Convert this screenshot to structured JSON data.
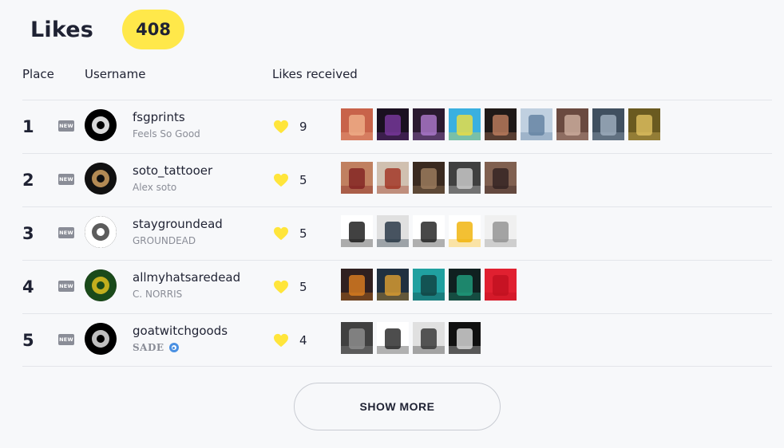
{
  "header": {
    "title": "Likes",
    "count": "408"
  },
  "columns": {
    "place": "Place",
    "username": "Username",
    "likes": "Likes received"
  },
  "new_label": "NEW",
  "rows": [
    {
      "place": "1",
      "username": "fsgprints",
      "subname": "Feels So Good",
      "likes": "9",
      "avatar_colors": [
        "#000000",
        "#ffffff"
      ],
      "thumb_colors": [
        [
          "#c8634a",
          "#f0b08a"
        ],
        [
          "#1a1020",
          "#7a3aa0"
        ],
        [
          "#2a1a30",
          "#b07ad0"
        ],
        [
          "#3ab0e0",
          "#f0e040"
        ],
        [
          "#201a18",
          "#c08060"
        ],
        [
          "#c0d0e0",
          "#6080a0"
        ],
        [
          "#6a4a40",
          "#d0b0a0"
        ],
        [
          "#405060",
          "#a0b0c0"
        ],
        [
          "#6a5a20",
          "#e0c060"
        ]
      ]
    },
    {
      "place": "2",
      "username": "soto_tattooer",
      "subname": "Alex soto",
      "likes": "5",
      "avatar_colors": [
        "#111111",
        "#d0a060"
      ],
      "thumb_colors": [
        [
          "#c08060",
          "#802020"
        ],
        [
          "#d0c0b0",
          "#a03020"
        ],
        [
          "#3a2a20",
          "#a08060"
        ],
        [
          "#404040",
          "#d0d0d0"
        ],
        [
          "#806050",
          "#302020"
        ]
      ]
    },
    {
      "place": "3",
      "username": "staygroundead",
      "subname": "GROUNDEAD",
      "likes": "5",
      "avatar_colors": [
        "#ffffff",
        "#404040"
      ],
      "thumb_colors": [
        [
          "#ffffff",
          "#111111"
        ],
        [
          "#e0e0e0",
          "#203040"
        ],
        [
          "#ffffff",
          "#1a1a1a"
        ],
        [
          "#ffffff",
          "#f0b000"
        ],
        [
          "#f0f0f0",
          "#909090"
        ]
      ]
    },
    {
      "place": "4",
      "username": "allmyhatsaredead",
      "subname": "C. NORRIS",
      "likes": "5",
      "avatar_colors": [
        "#1a4a1a",
        "#e0c020"
      ],
      "thumb_colors": [
        [
          "#302020",
          "#e08020"
        ],
        [
          "#203040",
          "#e0a030"
        ],
        [
          "#20a0a0",
          "#104040"
        ],
        [
          "#102020",
          "#20a080"
        ],
        [
          "#e02030",
          "#c01020"
        ]
      ]
    },
    {
      "place": "5",
      "username": "goatwitchgoods",
      "subname": "SADE",
      "likes": "4",
      "verified": true,
      "avatar_colors": [
        "#000000",
        "#e0e0e0"
      ],
      "thumb_colors": [
        [
          "#404040",
          "#909090"
        ],
        [
          "#ffffff",
          "#202020"
        ],
        [
          "#e0e0e0",
          "#303030"
        ],
        [
          "#101010",
          "#e0e0e0"
        ]
      ]
    }
  ],
  "show_more": "SHOW MORE",
  "colors": {
    "accent_yellow": "#ffe84a",
    "text": "#1f2233",
    "muted": "#8a8d97",
    "heart": "#ffe53b"
  },
  "icons": {
    "heart": "heart-icon",
    "verified": "verified-badge-icon"
  }
}
